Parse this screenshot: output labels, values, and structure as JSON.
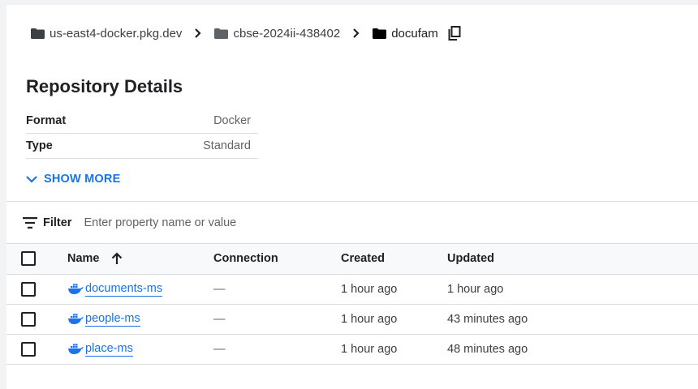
{
  "breadcrumb": {
    "items": [
      "us-east4-docker.pkg.dev",
      "cbse-2024ii-438402",
      "docufam"
    ]
  },
  "page": {
    "title": "Repository Details"
  },
  "details": {
    "rows": [
      {
        "key": "Format",
        "value": "Docker"
      },
      {
        "key": "Type",
        "value": "Standard"
      }
    ],
    "show_more_label": "SHOW MORE"
  },
  "filter": {
    "label": "Filter",
    "placeholder": "Enter property name or value"
  },
  "table": {
    "columns": {
      "name": "Name",
      "connection": "Connection",
      "created": "Created",
      "updated": "Updated"
    },
    "rows": [
      {
        "name": "documents-ms",
        "connection": "—",
        "created": "1 hour ago",
        "updated": "1 hour ago"
      },
      {
        "name": "people-ms",
        "connection": "—",
        "created": "1 hour ago",
        "updated": "43 minutes ago"
      },
      {
        "name": "place-ms",
        "connection": "—",
        "created": "1 hour ago",
        "updated": "48 minutes ago"
      }
    ]
  },
  "colors": {
    "link": "#1a73e8",
    "text": "#202124",
    "border": "#dadce0"
  }
}
